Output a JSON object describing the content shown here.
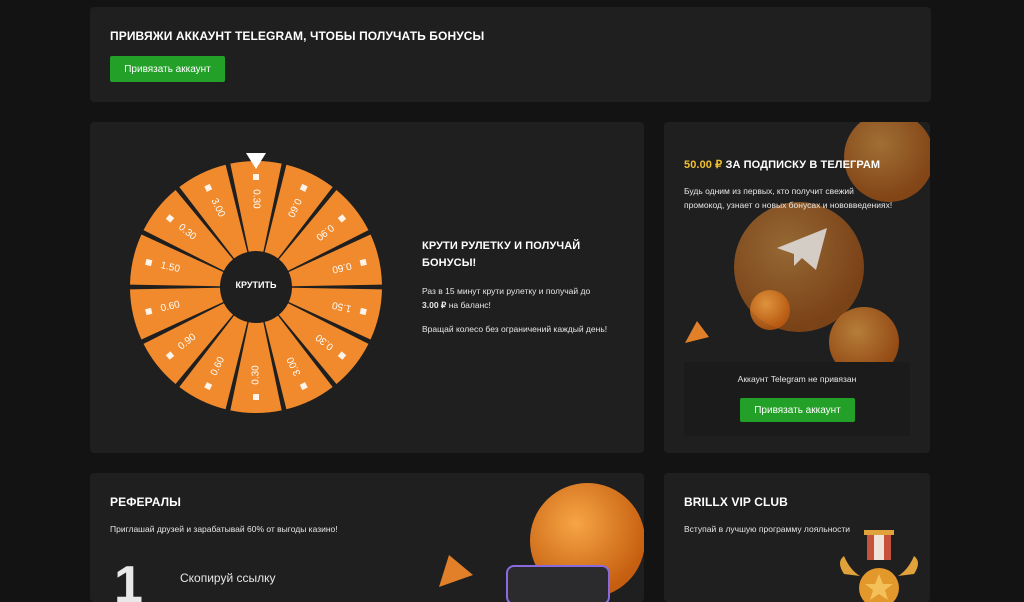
{
  "telegram_banner": {
    "title": "ПРИВЯЖИ АККАУНТ TELEGRAM, ЧТОБЫ ПОЛУЧАТЬ БОНУСЫ",
    "button_label": "Привязать аккаунт"
  },
  "wheel": {
    "center_label": "КРУТИТЬ",
    "segments": [
      "0.30",
      "0.60",
      "0.90",
      "0.60",
      "1.50",
      "0.30",
      "3.00",
      "0.30",
      "0.60",
      "0.90",
      "0.60",
      "1.50",
      "0.30",
      "3.00"
    ],
    "segment_color": "#f08a2c",
    "title_line1": "КРУТИ РУЛЕТКУ И ПОЛУЧАЙ",
    "title_line2": "БОНУСЫ!",
    "desc_prefix": "Раз в 15 минут крути рулетку и получай до",
    "desc_amount": "3.00 ₽",
    "desc_suffix": "на баланс!",
    "desc_line2": "Вращай колесо без ограничений каждый день!"
  },
  "subscribe": {
    "amount": "50.00 ₽",
    "title": "ЗА ПОДПИСКУ В ТЕЛЕГРАМ",
    "desc_line1": "Будь одним из первых, кто получит свежий",
    "desc_line2": "промокод, узнает о новых бонусах и нововведениях!",
    "status": "Аккаунт Telegram не привязан",
    "button_label": "Привязать аккаунт",
    "accent": "#f2c12e"
  },
  "referrals": {
    "title": "РЕФЕРАЛЫ",
    "desc": "Приглашай друзей и зарабатывай 60% от выгоды казино!",
    "step_number": "1",
    "step_label": "Скопируй ссылку"
  },
  "vip": {
    "title": "BRILLX VIP CLUB",
    "desc": "Вступай в лучшую программу лояльности"
  },
  "colors": {
    "green": "#23a028",
    "orange": "#f08a2c",
    "card": "#1f1f20",
    "bg": "#131313"
  }
}
